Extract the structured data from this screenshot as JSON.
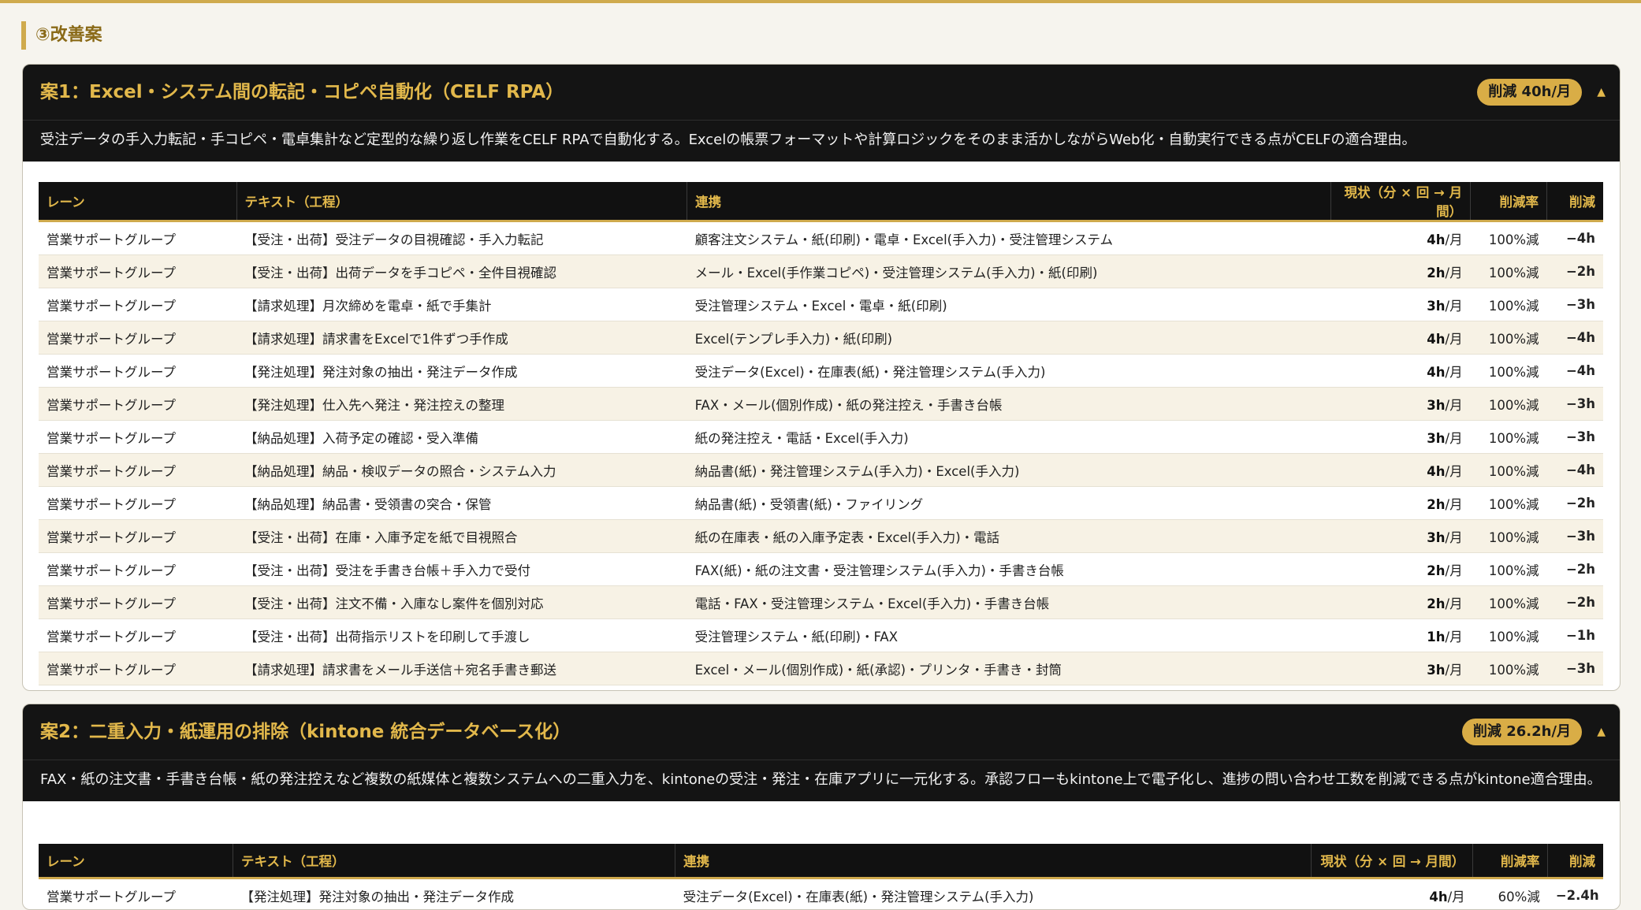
{
  "section_title": "③改善案",
  "columns": {
    "lane": "レーン",
    "text": "テキスト（工程）",
    "link": "連携",
    "current": "現状（分 × 回 → 月間）",
    "rate": "削減率",
    "reduction": "削減"
  },
  "plans": [
    {
      "title": "案1：Excel・システム間の転記・コピペ自動化（CELF RPA）",
      "badge": "削減 40h/月",
      "toggle": "▲",
      "description": "受注データの手入力転記・手コピペ・電卓集計など定型的な繰り返し作業をCELF RPAで自動化する。Excelの帳票フォーマットや計算ロジックをそのまま活かしながらWeb化・自動実行できる点がCELFの適合理由。",
      "rows": [
        {
          "lane": "営業サポートグループ",
          "text": "【受注・出荷】受注データの目視確認・手入力転記",
          "link": "顧客注文システム・紙(印刷)・電卓・Excel(手入力)・受注管理システム",
          "current_value": "4h",
          "current_unit": "/月",
          "rate": "100%減",
          "reduction": "−4h"
        },
        {
          "lane": "営業サポートグループ",
          "text": "【受注・出荷】出荷データを手コピペ・全件目視確認",
          "link": "メール・Excel(手作業コピペ)・受注管理システム(手入力)・紙(印刷)",
          "current_value": "2h",
          "current_unit": "/月",
          "rate": "100%減",
          "reduction": "−2h"
        },
        {
          "lane": "営業サポートグループ",
          "text": "【請求処理】月次締めを電卓・紙で手集計",
          "link": "受注管理システム・Excel・電卓・紙(印刷)",
          "current_value": "3h",
          "current_unit": "/月",
          "rate": "100%減",
          "reduction": "−3h"
        },
        {
          "lane": "営業サポートグループ",
          "text": "【請求処理】請求書をExcelで1件ずつ手作成",
          "link": "Excel(テンプレ手入力)・紙(印刷)",
          "current_value": "4h",
          "current_unit": "/月",
          "rate": "100%減",
          "reduction": "−4h"
        },
        {
          "lane": "営業サポートグループ",
          "text": "【発注処理】発注対象の抽出・発注データ作成",
          "link": "受注データ(Excel)・在庫表(紙)・発注管理システム(手入力)",
          "current_value": "4h",
          "current_unit": "/月",
          "rate": "100%減",
          "reduction": "−4h"
        },
        {
          "lane": "営業サポートグループ",
          "text": "【発注処理】仕入先へ発注・発注控えの整理",
          "link": "FAX・メール(個別作成)・紙の発注控え・手書き台帳",
          "current_value": "3h",
          "current_unit": "/月",
          "rate": "100%減",
          "reduction": "−3h"
        },
        {
          "lane": "営業サポートグループ",
          "text": "【納品処理】入荷予定の確認・受入準備",
          "link": "紙の発注控え・電話・Excel(手入力)",
          "current_value": "3h",
          "current_unit": "/月",
          "rate": "100%減",
          "reduction": "−3h"
        },
        {
          "lane": "営業サポートグループ",
          "text": "【納品処理】納品・検収データの照合・システム入力",
          "link": "納品書(紙)・発注管理システム(手入力)・Excel(手入力)",
          "current_value": "4h",
          "current_unit": "/月",
          "rate": "100%減",
          "reduction": "−4h"
        },
        {
          "lane": "営業サポートグループ",
          "text": "【納品処理】納品書・受領書の突合・保管",
          "link": "納品書(紙)・受領書(紙)・ファイリング",
          "current_value": "2h",
          "current_unit": "/月",
          "rate": "100%減",
          "reduction": "−2h"
        },
        {
          "lane": "営業サポートグループ",
          "text": "【受注・出荷】在庫・入庫予定を紙で目視照合",
          "link": "紙の在庫表・紙の入庫予定表・Excel(手入力)・電話",
          "current_value": "3h",
          "current_unit": "/月",
          "rate": "100%減",
          "reduction": "−3h"
        },
        {
          "lane": "営業サポートグループ",
          "text": "【受注・出荷】受注を手書き台帳＋手入力で受付",
          "link": "FAX(紙)・紙の注文書・受注管理システム(手入力)・手書き台帳",
          "current_value": "2h",
          "current_unit": "/月",
          "rate": "100%減",
          "reduction": "−2h"
        },
        {
          "lane": "営業サポートグループ",
          "text": "【受注・出荷】注文不備・入庫なし案件を個別対応",
          "link": "電話・FAX・受注管理システム・Excel(手入力)・手書き台帳",
          "current_value": "2h",
          "current_unit": "/月",
          "rate": "100%減",
          "reduction": "−2h"
        },
        {
          "lane": "営業サポートグループ",
          "text": "【受注・出荷】出荷指示リストを印刷して手渡し",
          "link": "受注管理システム・紙(印刷)・FAX",
          "current_value": "1h",
          "current_unit": "/月",
          "rate": "100%減",
          "reduction": "−1h"
        },
        {
          "lane": "営業サポートグループ",
          "text": "【請求処理】請求書をメール手送信＋宛名手書き郵送",
          "link": "Excel・メール(個別作成)・紙(承認)・プリンタ・手書き・封筒",
          "current_value": "3h",
          "current_unit": "/月",
          "rate": "100%減",
          "reduction": "−3h"
        }
      ]
    },
    {
      "title": "案2：二重入力・紙運用の排除（kintone 統合データベース化）",
      "badge": "削減 26.2h/月",
      "toggle": "▲",
      "description": "FAX・紙の注文書・手書き台帳・紙の発注控えなど複数の紙媒体と複数システムへの二重入力を、kintoneの受注・発注・在庫アプリに一元化する。承認フローもkintone上で電子化し、進捗の問い合わせ工数を削減できる点がkintone適合理由。",
      "rows": [
        {
          "lane": "営業サポートグループ",
          "text": "【発注処理】発注対象の抽出・発注データ作成",
          "link": "受注データ(Excel)・在庫表(紙)・発注管理システム(手入力)",
          "current_value": "4h",
          "current_unit": "/月",
          "rate": "60%減",
          "reduction": "−2.4h"
        }
      ]
    }
  ]
}
